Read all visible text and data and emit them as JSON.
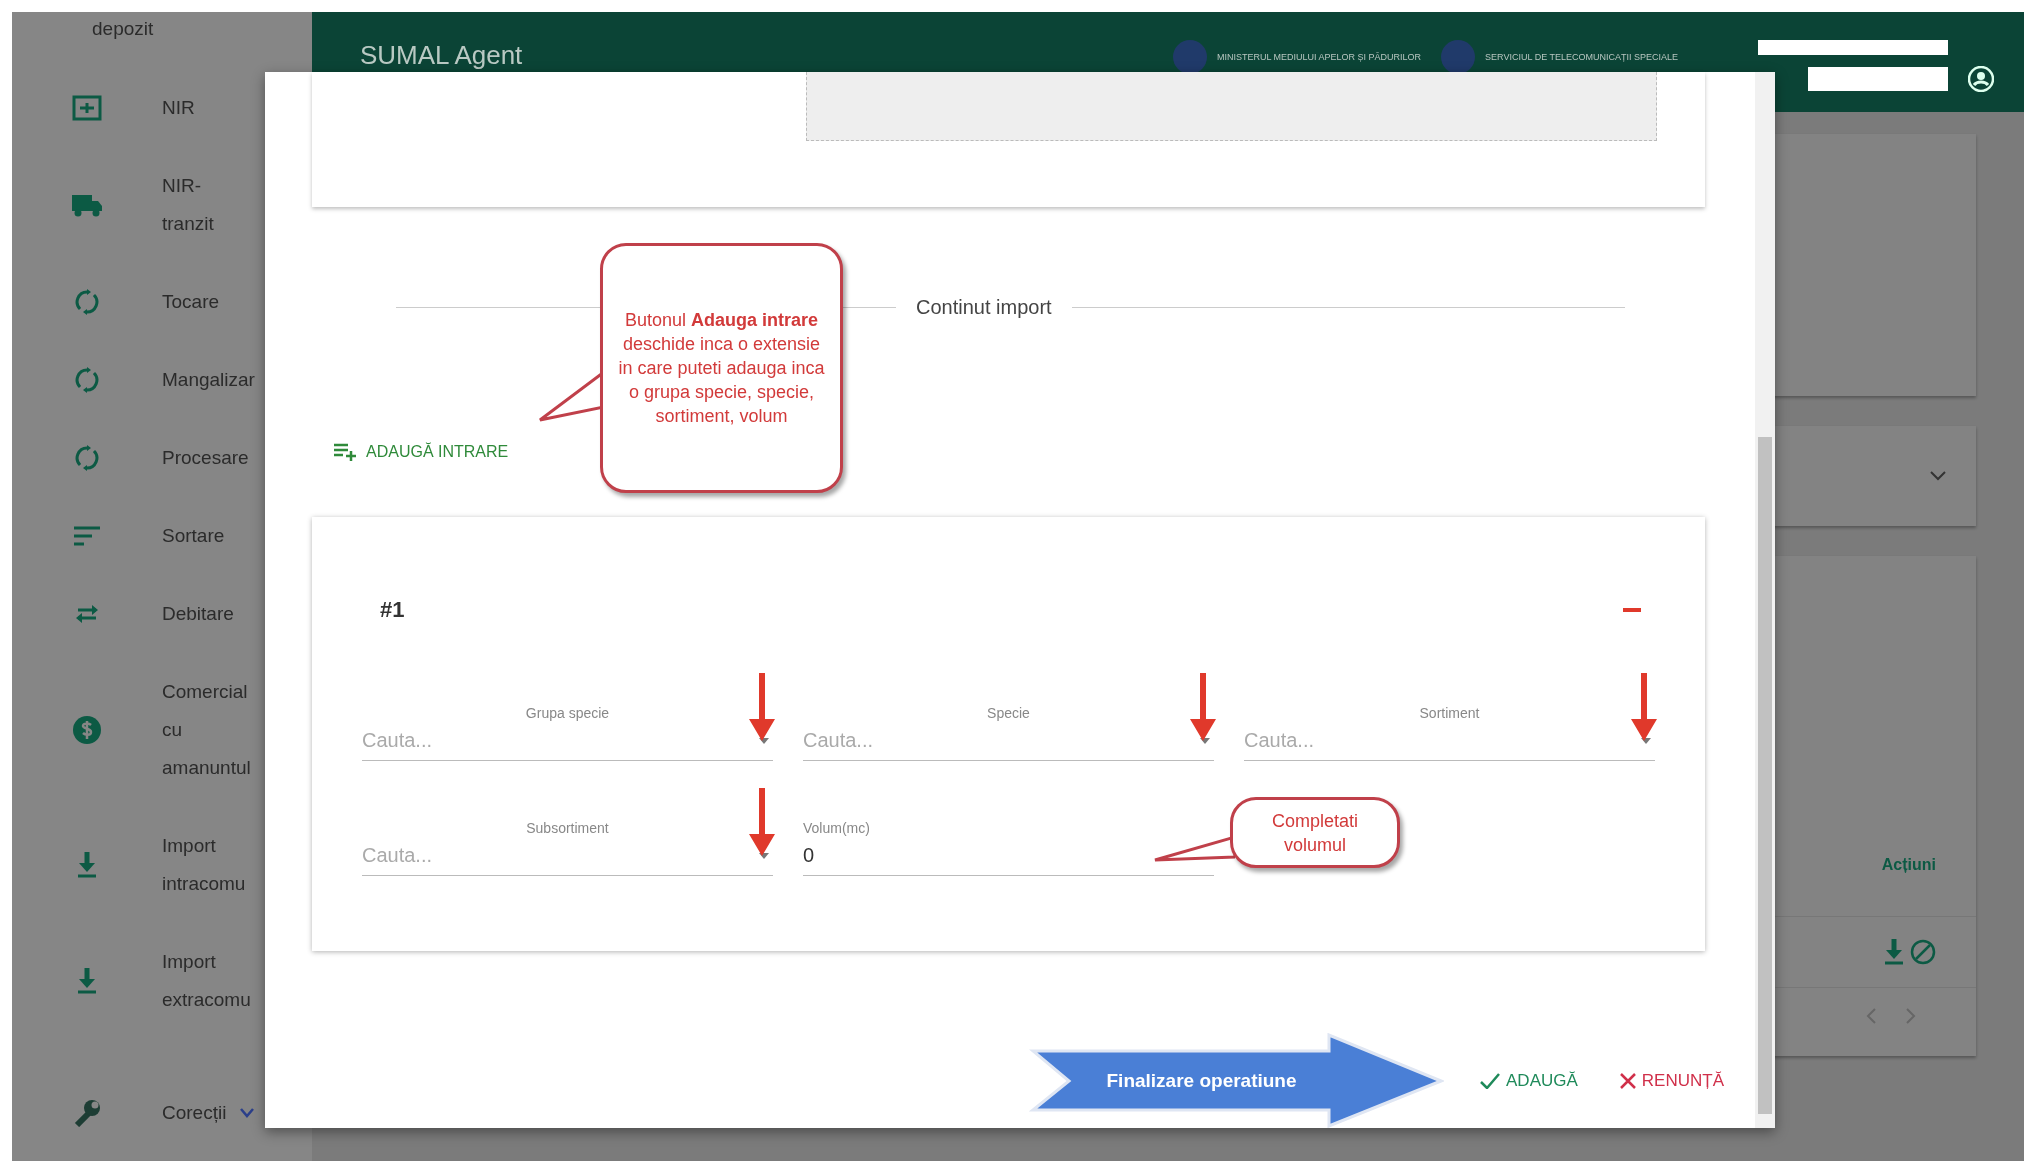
{
  "header": {
    "title": "SUMAL Agent",
    "logos": [
      {
        "caption": "MINISTERUL MEDIULUI APELOR ȘI PĂDURILOR"
      },
      {
        "caption": "SERVICIUL DE TELECOMUNICAȚII SPECIALE"
      }
    ]
  },
  "sidebar": {
    "items": [
      {
        "kind": "plain",
        "label": "depozit"
      },
      {
        "kind": "document",
        "label": "NIR"
      },
      {
        "kind": "truck",
        "label": "NIR-\ntranzit"
      },
      {
        "kind": "cycle",
        "label": "Tocare"
      },
      {
        "kind": "cycle",
        "label": "Mangalizar"
      },
      {
        "kind": "cycle",
        "label": "Procesare"
      },
      {
        "kind": "sort",
        "label": "Sortare"
      },
      {
        "kind": "swap",
        "label": "Debitare"
      },
      {
        "kind": "dollar",
        "label": "Comercial\ncu\namanuntul"
      },
      {
        "kind": "download",
        "label": "Import\nintracomu"
      },
      {
        "kind": "download",
        "label": "Import\nextracomu"
      },
      {
        "kind": "wrench",
        "label": "Corecții",
        "expandable": true
      }
    ]
  },
  "table": {
    "column_header": "Acțiuni"
  },
  "modal": {
    "section_title": "Continut import",
    "add_button": "ADAUGĂ INTRARE",
    "entries": [
      {
        "number": "#1",
        "fields": [
          {
            "kind": "select",
            "label": "Grupa specie",
            "placeholder": "Cauta...",
            "annotated": true
          },
          {
            "kind": "select",
            "label": "Specie",
            "placeholder": "Cauta...",
            "annotated": true
          },
          {
            "kind": "select",
            "label": "Sortiment",
            "placeholder": "Cauta...",
            "annotated": true
          },
          {
            "kind": "select",
            "label": "Subsortiment",
            "placeholder": "Cauta...",
            "annotated": true
          },
          {
            "kind": "number",
            "label": "Volum(mc)",
            "value": "0",
            "annotated": false
          }
        ]
      }
    ],
    "actions": [
      {
        "kind": "confirm",
        "label": "ADAUGĂ"
      },
      {
        "kind": "cancel",
        "label": "RENUNȚĂ"
      }
    ]
  },
  "annotations": [
    {
      "kind": "callout",
      "text": "Butonul **Adauga intrare** deschide inca o extensie in care puteti adauga inca o grupa specie, specie, sortiment, volum"
    },
    {
      "kind": "callout",
      "text": "Completati volumul"
    },
    {
      "kind": "arrow",
      "text": "Finalizare operatiune"
    }
  ]
}
